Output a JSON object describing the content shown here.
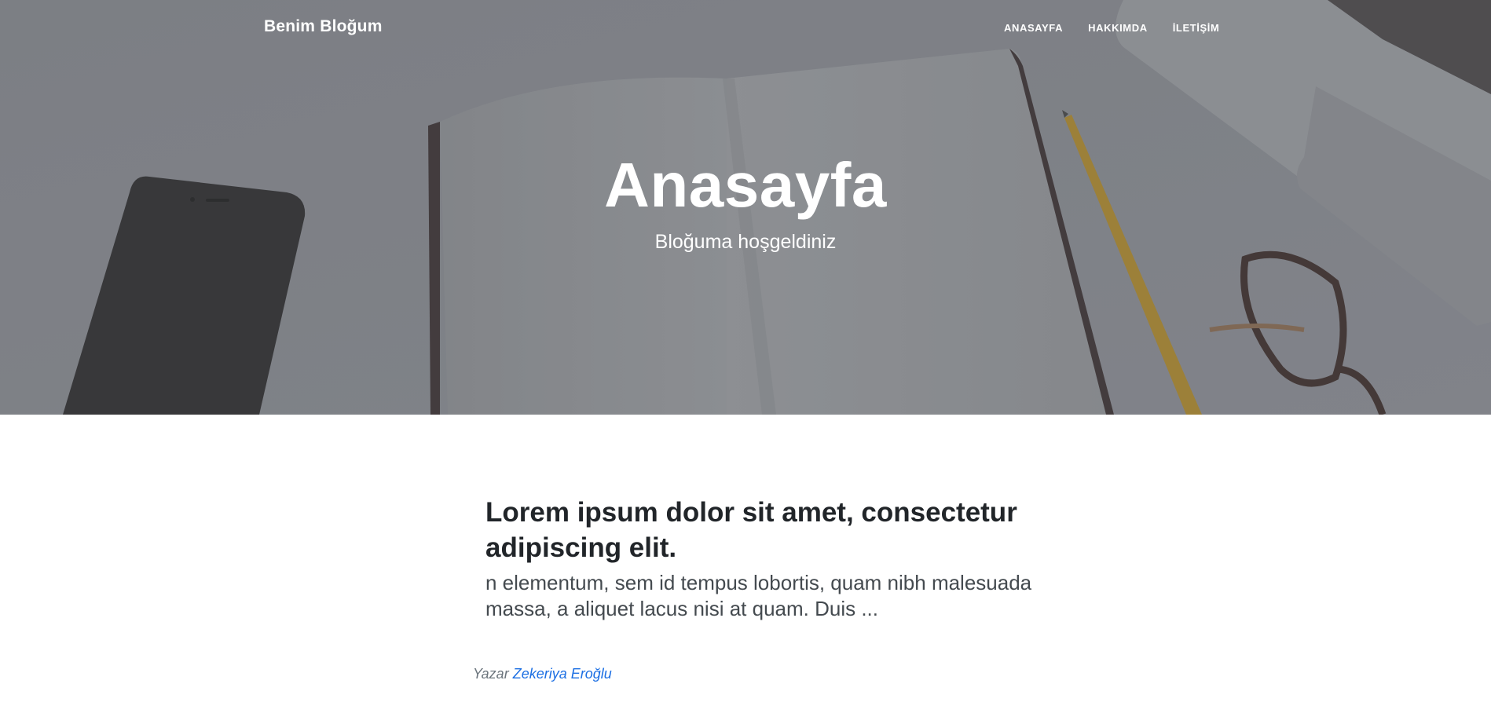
{
  "navbar": {
    "brand": "Benim Bloğum",
    "links": [
      {
        "label": "ANASAYFA"
      },
      {
        "label": "HAKKIMDA"
      },
      {
        "label": "İLETİŞİM"
      }
    ]
  },
  "hero": {
    "title": "Anasayfa",
    "subtitle": "Bloğuma hoşgeldiniz"
  },
  "post": {
    "title": "Lorem ipsum dolor sit amet, consectetur adipiscing elit.",
    "subtitle": "n elementum, sem id tempus lobortis, quam nibh malesuada massa, a aliquet lacus nisi at quam. Duis ...",
    "meta_prefix": "Yazar",
    "author": "Zekeriya Eroğlu"
  },
  "colors": {
    "text_dark": "#212529",
    "link": "#1c6fe3",
    "muted": "#6c757d"
  }
}
